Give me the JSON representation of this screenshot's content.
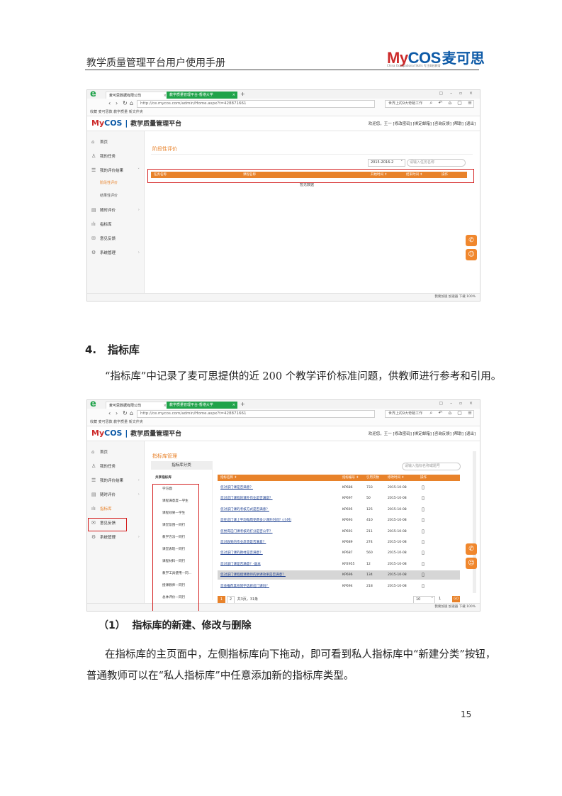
{
  "header": {
    "title": "教学质量管理平台用户使用手册",
    "logo_my": "My",
    "logo_cos": "COS",
    "logo_cn": "麦可思",
    "logo_tagline": "China Occupational Skills 专注高校教育"
  },
  "browser": {
    "tab1": "麦可思数据有限公司",
    "tab2": "教学质量管理平台-香港大学",
    "url": "http://ce.mycos.com/admin/Home.aspx?t=428871661",
    "search_text": "世界上的9大奇葩工作",
    "favorites": "收藏  麦可思数  教学质量  新文件夹",
    "status": "我要加速  加速器  下载  100%"
  },
  "app": {
    "logo_my": "My",
    "logo_cos": "COS",
    "logo_name": "教学质量管理平台",
    "usernav": "欢迎您，王一  [修改密码] [绑定邮箱] [咨询反馈] [帮助] [退出]"
  },
  "shot1": {
    "sidebar": {
      "home": "首页",
      "tasks": "我的任务",
      "results": "我的评价结果",
      "stage_eval": "阶段性评价",
      "final_eval": "结果性评价",
      "instant_eval": "随时评价",
      "indicator_lib": "指标库",
      "feedback": "意见反馈",
      "settings": "系统管理"
    },
    "page_title": "阶段性评价",
    "term_select": "2015-2016-2",
    "search_placeholder": "请输入任务名称",
    "columns": [
      "任务名称",
      "课程名称",
      "开始时间 ⇕",
      "结束时间 ⇕",
      "操作"
    ],
    "empty_text": "暂无数据"
  },
  "section": {
    "number": "4.",
    "title": "指标库",
    "intro": "“指标库”中记录了麦可思提供的近 200 个教学评价标准问题，供教师进行参考和引用。"
  },
  "shot2": {
    "sidebar": {
      "home": "首页",
      "tasks": "我的任务",
      "results": "我的评价结果",
      "instant_eval": "随时评价",
      "indicator_lib": "指标库",
      "feedback": "意见反馈",
      "settings": "系统管理"
    },
    "page_title": "指标库管理",
    "category_header": "指标库分类",
    "shared_lib": "共享指标库",
    "categories": [
      "学方面",
      "课程满意度—学生",
      "课程效果—学生",
      "课堂氛围—同行",
      "教学方法—同行",
      "课堂表现—同行",
      "课程材料—同行",
      "教学工具使用—同...",
      "授课教师—同行",
      "总体评价—同行"
    ],
    "search_placeholder": "请输入指标名称或题号",
    "columns": [
      "指标名称 ⇕",
      "指标编号 ⇕",
      "引用次数",
      "修改时间 ⇕",
      "操作"
    ],
    "rows": [
      {
        "name": "您对该门课是否满意？",
        "code": "KP686",
        "count": "733",
        "date": "2015-10-08"
      },
      {
        "name": "您对这门课程的课外作业是否满意？",
        "code": "KP697",
        "count": "50",
        "date": "2015-10-08"
      },
      {
        "name": "您对该门课的考核方式是否满意？",
        "code": "KP695",
        "count": "125",
        "date": "2015-10-08"
      },
      {
        "name": "您在这门课上平均每周花费多少课外时间？(小时)",
        "code": "KP693",
        "count": "410",
        "date": "2015-10-08"
      },
      {
        "name": "您觉得这门课考核的打分是否公平？",
        "code": "KP691",
        "count": "211",
        "date": "2015-10-08"
      },
      {
        "name": "您对收到的作业反馈是否满意？",
        "code": "KP689",
        "count": "274",
        "date": "2015-10-08"
      },
      {
        "name": "您对该门课的教材是否满意？",
        "code": "KP687",
        "count": "560",
        "date": "2015-10-08"
      },
      {
        "name": "您对该门课是否满意？-副本",
        "code": "KP2955",
        "count": "12",
        "date": "2015-10-08"
      },
      {
        "name": "您对该门课程授课教师的讲课效果是否满意？",
        "code": "KP696",
        "count": "134",
        "date": "2015-10-08"
      },
      {
        "name": "您会推荐其他同学选修这门课吗？",
        "code": "KP694",
        "count": "218",
        "date": "2015-10-08"
      }
    ],
    "pager_info": "共3页，31条",
    "page_size": "10",
    "go_label": "GO",
    "page1": "1",
    "page2": "2"
  },
  "subsection": {
    "number": "（1）",
    "title": "指标库的新建、修改与删除"
  },
  "body": {
    "line1": "在指标库的主页面中，左侧指标库向下拖动，即可看到私人指标库中“新建分类”按钮，",
    "line2": "普通教师可以在“私人指标库”中任意添加新的指标库类型。"
  },
  "page_number": "15",
  "colors": {
    "accent": "#e8822a",
    "brand_blue": "#0d5aa7",
    "brand_red": "#cc2a2a",
    "highlight": "#d42020",
    "browser_green": "#1fa34a"
  }
}
